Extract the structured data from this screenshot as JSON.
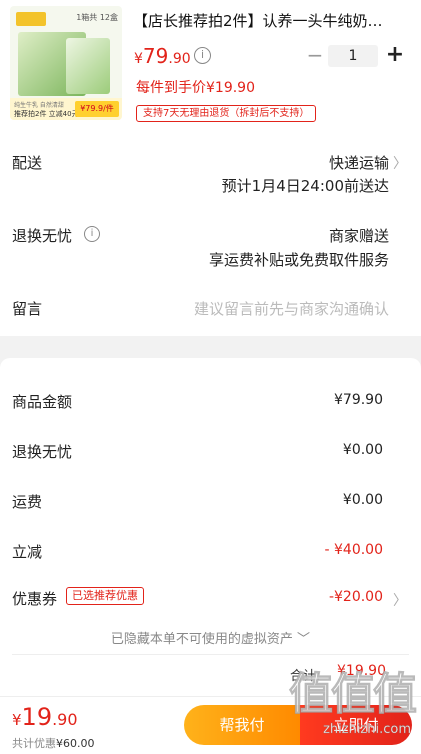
{
  "product": {
    "thumb_spec": "1箱共 12盒",
    "thumb_line1": "纯生牛乳 自然清甜",
    "thumb_line2": "推荐拍2件 立减40元",
    "thumb_price": "¥79.9/件",
    "title": "【店长推荐拍2件】认养一头牛纯奶…",
    "price_currency": "¥",
    "price_int": "79",
    "price_dec": ".90",
    "quantity": "1",
    "per_price": "每件到手价¥19.90",
    "return_badge": "支持7天无理由退货（拆封后不支持）"
  },
  "shipping": {
    "delivery_label": "配送",
    "delivery_method": "快递运输",
    "delivery_eta": "预计1月4日24:00前送达",
    "return_label": "退换无忧",
    "return_value": "商家赠送",
    "return_desc": "享运费补贴或免费取件服务",
    "note_label": "留言",
    "note_placeholder": "建议留言前先与商家沟通确认"
  },
  "summary": {
    "rows": [
      {
        "label": "商品金额",
        "value": "¥79.90"
      },
      {
        "label": "退换无忧",
        "value": "¥0.00"
      },
      {
        "label": "运费",
        "value": "¥0.00"
      },
      {
        "label": "立减",
        "value": "- ¥40.00"
      },
      {
        "label": "优惠券",
        "value": "-¥20.00"
      }
    ],
    "promo_tag": "已选推荐优惠",
    "hidden_note": "已隐藏本单不可使用的虚拟资产 ﹀",
    "total_label": "合计:",
    "total_value": "¥19.90"
  },
  "bottom": {
    "price_currency": "¥",
    "price_int": "19",
    "price_dec": ".90",
    "saving_prefix": "共计优惠",
    "saving_value": "¥60.00",
    "help_pay": "帮我付",
    "pay": "立即付"
  },
  "watermark": {
    "text": "值值值",
    "url": "zhizhizhi.com"
  },
  "colors": {
    "accent_red": "#e2231a",
    "help_button": "#ffa412"
  }
}
